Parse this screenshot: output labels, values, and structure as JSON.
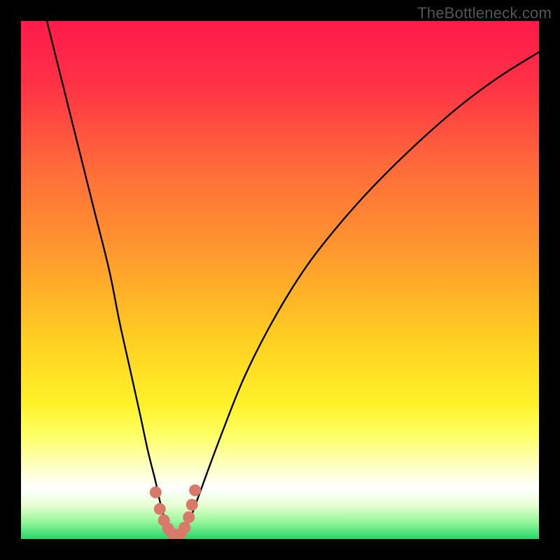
{
  "watermark": {
    "text": "TheBottleneck.com"
  },
  "colors": {
    "black": "#000000",
    "curve": "#000000",
    "marker": "#d9796c",
    "gradient_stops": [
      {
        "offset": 0.0,
        "color": "#ff1a4b"
      },
      {
        "offset": 0.12,
        "color": "#ff3146"
      },
      {
        "offset": 0.28,
        "color": "#ff6a3a"
      },
      {
        "offset": 0.45,
        "color": "#ff9a2e"
      },
      {
        "offset": 0.62,
        "color": "#ffd021"
      },
      {
        "offset": 0.74,
        "color": "#fff22a"
      },
      {
        "offset": 0.8,
        "color": "#ffff66"
      },
      {
        "offset": 0.86,
        "color": "#ffffc4"
      },
      {
        "offset": 0.9,
        "color": "#ffffff"
      },
      {
        "offset": 0.935,
        "color": "#e7ffd4"
      },
      {
        "offset": 0.965,
        "color": "#9cf79c"
      },
      {
        "offset": 1.0,
        "color": "#27d66b"
      }
    ]
  },
  "chart_data": {
    "type": "line",
    "title": "",
    "xlabel": "",
    "ylabel": "",
    "xlim": [
      0,
      100
    ],
    "ylim": [
      0,
      100
    ],
    "grid": false,
    "legend": false,
    "series": [
      {
        "name": "bottleneck-curve",
        "x": [
          5,
          8,
          11,
          14,
          17,
          19,
          21,
          23,
          24.5,
          26,
          27,
          28,
          29,
          30,
          31,
          32.5,
          34,
          36,
          39,
          43,
          48,
          54,
          60,
          67,
          75,
          84,
          92,
          100
        ],
        "y": [
          100,
          88,
          76,
          64,
          52,
          42,
          33,
          24,
          17,
          11,
          6.5,
          3.2,
          1.4,
          0.6,
          1.4,
          3.6,
          7.5,
          13,
          21,
          31,
          41,
          51,
          59,
          67,
          75,
          83,
          89,
          94
        ]
      }
    ],
    "markers": {
      "name": "highlighted-points",
      "x": [
        26.0,
        26.8,
        27.6,
        28.4,
        29.2,
        30.0,
        30.8,
        31.6,
        32.4,
        33.0,
        33.6
      ],
      "y": [
        9.0,
        5.8,
        3.6,
        2.0,
        1.0,
        0.6,
        1.0,
        2.2,
        4.2,
        6.6,
        9.4
      ]
    }
  }
}
